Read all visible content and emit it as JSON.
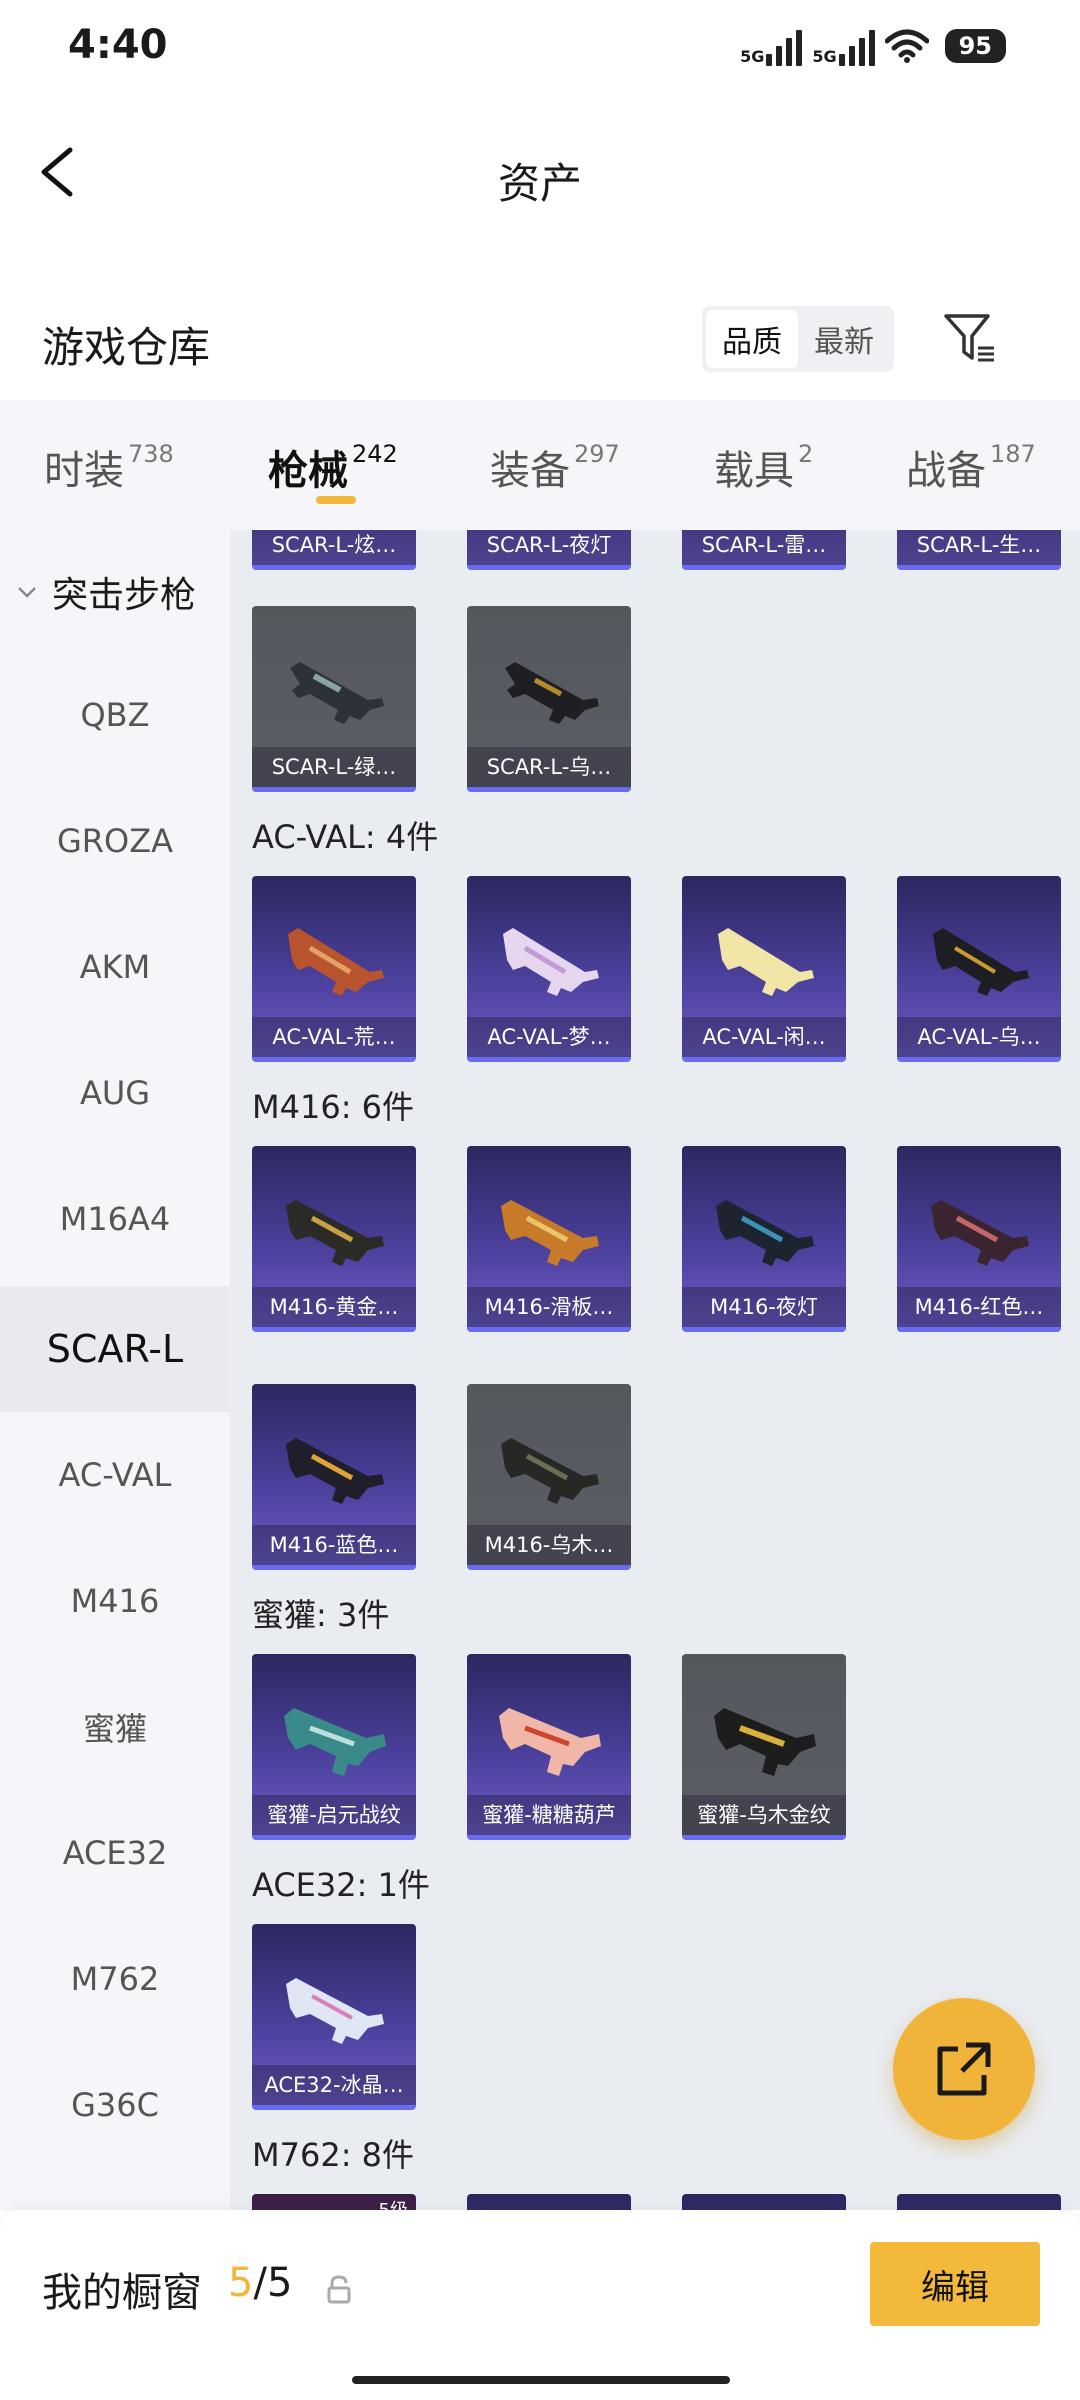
{
  "status_bar": {
    "time": "4:40",
    "network1": "5G",
    "network2": "5G",
    "battery": "95"
  },
  "header": {
    "title": "资产"
  },
  "warehouse": {
    "title": "游戏仓库",
    "sort_options": [
      "品质",
      "最新"
    ],
    "active_sort": "品质"
  },
  "tabs": [
    {
      "label": "时装",
      "count": "738"
    },
    {
      "label": "枪械",
      "count": "242"
    },
    {
      "label": "装备",
      "count": "297"
    },
    {
      "label": "载具",
      "count": "2"
    },
    {
      "label": "战备",
      "count": "187"
    }
  ],
  "sidebar": {
    "group": "突击步枪",
    "items": [
      "QBZ",
      "GROZA",
      "AKM",
      "AUG",
      "M16A4",
      "SCAR-L",
      "AC-VAL",
      "M416",
      "蜜獾",
      "ACE32",
      "M762",
      "G36C"
    ],
    "active": "SCAR-L"
  },
  "content": {
    "top_partial": [
      "SCAR-L-炫…",
      "SCAR-L-夜灯",
      "SCAR-L-雷…",
      "SCAR-L-生…"
    ],
    "sections": [
      {
        "title": "",
        "items": [
          "SCAR-L-绿…",
          "SCAR-L-乌…"
        ]
      },
      {
        "title": "AC-VAL: 4件",
        "items": [
          "AC-VAL-荒…",
          "AC-VAL-梦…",
          "AC-VAL-闲…",
          "AC-VAL-乌…"
        ]
      },
      {
        "title": "M416: 6件",
        "items": [
          "M416-黄金…",
          "M416-滑板…",
          "M416-夜灯",
          "M416-红色…",
          "M416-蓝色…",
          "M416-乌木…"
        ]
      },
      {
        "title": "蜜獾: 3件",
        "items": [
          "蜜獾-启元战纹",
          "蜜獾-糖糖葫芦",
          "蜜獾-乌木金纹"
        ]
      },
      {
        "title": "ACE32: 1件",
        "items": [
          "ACE32-冰晶…"
        ]
      },
      {
        "title": "M762: 8件",
        "items": []
      }
    ],
    "m762_badge": "5级"
  },
  "colors": {
    "accent": "#f2b63a",
    "card_purple": "#4a3f9a",
    "card_gray": "#5c5e66"
  },
  "bottom_bar": {
    "label": "我的橱窗",
    "current": "5",
    "separator": "/",
    "total": "5",
    "edit": "编辑"
  }
}
